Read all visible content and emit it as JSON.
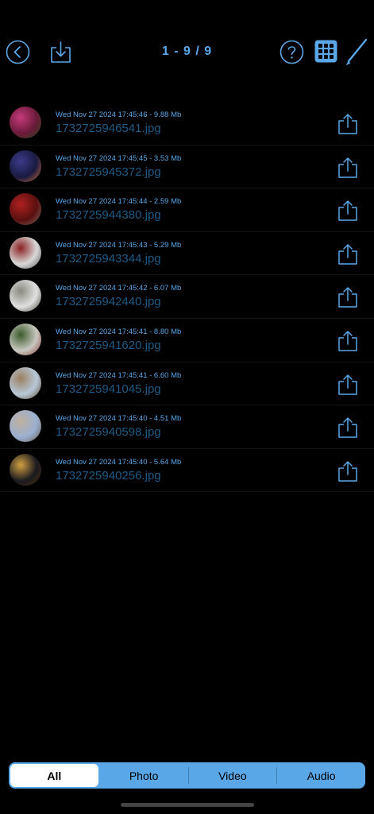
{
  "header": {
    "counter": "1 - 9 / 9",
    "icons": [
      "back-icon",
      "download-icon",
      "help-icon",
      "grid-view-icon",
      "edit-pencil-icon"
    ]
  },
  "files": [
    {
      "meta": "Wed Nov 27 2024 17:45:46 - 9.88 Mb",
      "name": "1732725946541.jpg",
      "thumb_colors": [
        "#6a1a3a",
        "#c43a7a",
        "#2a4a1a"
      ]
    },
    {
      "meta": "Wed Nov 27 2024 17:45:45 - 3.53 Mb",
      "name": "1732725945372.jpg",
      "thumb_colors": [
        "#1a1a40",
        "#3a3a8a",
        "#d0703a"
      ]
    },
    {
      "meta": "Wed Nov 27 2024 17:45:44 - 2.59 Mb",
      "name": "1732725944380.jpg",
      "thumb_colors": [
        "#5a1010",
        "#b02020",
        "#7a6a5a"
      ]
    },
    {
      "meta": "Wed Nov 27 2024 17:45:43 - 5.29 Mb",
      "name": "1732725943344.jpg",
      "thumb_colors": [
        "#d8d8d8",
        "#8a2020",
        "#555555"
      ]
    },
    {
      "meta": "Wed Nov 27 2024 17:45:42 - 6.07 Mb",
      "name": "1732725942440.jpg",
      "thumb_colors": [
        "#e0e0e0",
        "#8a8a80",
        "#3a3a30"
      ]
    },
    {
      "meta": "Wed Nov 27 2024 17:45:41 - 8.80 Mb",
      "name": "1732725941620.jpg",
      "thumb_colors": [
        "#c8c8c0",
        "#3a5a2a",
        "#8a3a3a"
      ]
    },
    {
      "meta": "Wed Nov 27 2024 17:45:41 - 6.60 Mb",
      "name": "1732725941045.jpg",
      "thumb_colors": [
        "#b8c8d8",
        "#9a8060",
        "#5a4a30"
      ]
    },
    {
      "meta": "Wed Nov 27 2024 17:45:40 - 4.51 Mb",
      "name": "1732725940598.jpg",
      "thumb_colors": [
        "#9ab0d0",
        "#c0b0a0",
        "#6a5a4a"
      ]
    },
    {
      "meta": "Wed Nov 27 2024 17:45:40 - 5.64 Mb",
      "name": "1732725940256.jpg",
      "thumb_colors": [
        "#1a1a20",
        "#d0a040",
        "#503010"
      ]
    }
  ],
  "tabs": [
    {
      "label": "All",
      "active": true
    },
    {
      "label": "Photo",
      "active": false
    },
    {
      "label": "Video",
      "active": false
    },
    {
      "label": "Audio",
      "active": false
    }
  ],
  "colors": {
    "accent": "#5aa7e8",
    "filename": "#1f5b86",
    "background": "#000000"
  }
}
